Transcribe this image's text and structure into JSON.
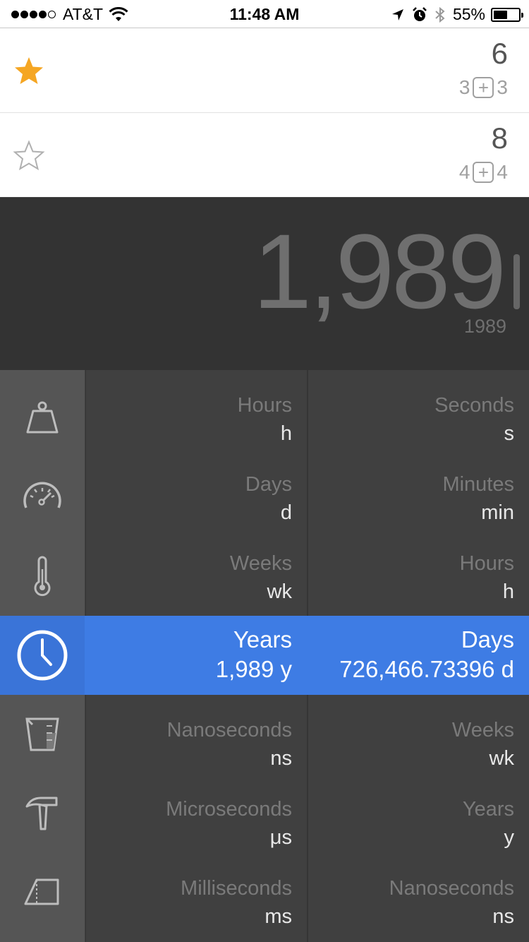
{
  "status_bar": {
    "carrier": "AT&T",
    "time": "11:48 AM",
    "battery": "55%",
    "battery_level": 0.55,
    "signal_bars": 4
  },
  "favorites": [
    {
      "starred": true,
      "total": "6",
      "left": "3",
      "op": "+",
      "right": "3"
    },
    {
      "starred": false,
      "total": "8",
      "left": "4",
      "op": "+",
      "right": "4"
    }
  ],
  "display": {
    "value": "1,989",
    "raw": "1989"
  },
  "categories": [
    {
      "icon": "weight-icon"
    },
    {
      "icon": "speedometer-icon"
    },
    {
      "icon": "thermometer-icon"
    },
    {
      "icon": "clock-icon",
      "selected": true
    },
    {
      "icon": "measuring-cup-icon"
    },
    {
      "icon": "hammer-icon"
    },
    {
      "icon": "area-icon"
    }
  ],
  "rows_above": [
    {
      "from_name": "Hours",
      "from_abbr": "h",
      "to_name": "Seconds",
      "to_abbr": "s"
    },
    {
      "from_name": "Days",
      "from_abbr": "d",
      "to_name": "Minutes",
      "to_abbr": "min"
    },
    {
      "from_name": "Weeks",
      "from_abbr": "wk",
      "to_name": "Hours",
      "to_abbr": "h"
    }
  ],
  "selected_row": {
    "from_name": "Years",
    "from_value": "1,989 y",
    "to_name": "Days",
    "to_value": "726,466.73396 d"
  },
  "rows_below": [
    {
      "from_name": "Nanoseconds",
      "from_abbr": "ns",
      "to_name": "Weeks",
      "to_abbr": "wk"
    },
    {
      "from_name": "Microseconds",
      "from_abbr": "μs",
      "to_name": "Years",
      "to_abbr": "y"
    },
    {
      "from_name": "Milliseconds",
      "from_abbr": "ms",
      "to_name": "Nanoseconds",
      "to_abbr": "ns"
    }
  ],
  "colors": {
    "accent": "#3e7ce4",
    "star": "#f5a623"
  }
}
